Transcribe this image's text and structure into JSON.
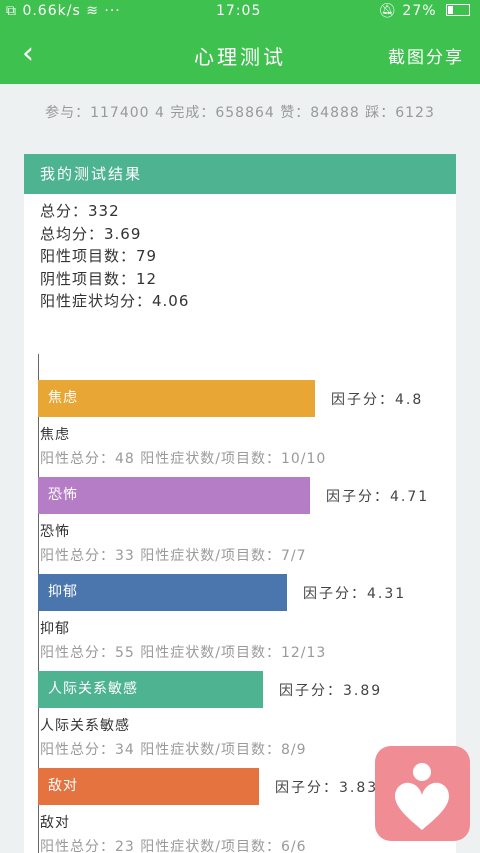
{
  "status": {
    "speed": "0.66k/s",
    "dots": "···",
    "time": "17:05",
    "battery": "27%"
  },
  "appbar": {
    "back": "‹",
    "title": "心理测试",
    "share": "截图分享"
  },
  "stats": "参与：117400 4 完成：658864 赞：84888 踩：6123",
  "card": {
    "header": "我的测试结果",
    "summary": [
      "总分：332",
      "总均分：3.69",
      "阳性项目数：79",
      "阴性项目数：12",
      "阳性症状均分：4.06"
    ]
  },
  "chart_data": {
    "type": "bar",
    "orientation": "horizontal",
    "categories": [
      "焦虑",
      "恐怖",
      "抑郁",
      "人际关系敏感",
      "敌对"
    ],
    "values": [
      4.8,
      4.71,
      4.31,
      3.89,
      3.83
    ],
    "value_labels": [
      "因子分：4.8",
      "因子分：4.71",
      "因子分：4.31",
      "因子分：3.89",
      "因子分：3.83"
    ],
    "colors": [
      "#e8a634",
      "#b57dc5",
      "#4a76ad",
      "#4db390",
      "#e57340"
    ],
    "xlim": [
      0,
      5
    ]
  },
  "factors": [
    {
      "name": "焦虑",
      "detail": "阳性总分：48   阳性症状数/项目数：10/10"
    },
    {
      "name": "恐怖",
      "detail": "阳性总分：33   阳性症状数/项目数：7/7"
    },
    {
      "name": "抑郁",
      "detail": "阳性总分：55   阳性症状数/项目数：12/13"
    },
    {
      "name": "人际关系敏感",
      "detail": "阳性总分：34   阳性症状数/项目数：8/9"
    },
    {
      "name": "敌对",
      "detail": "阳性总分：23   阳性症状数/项目数：6/6"
    }
  ]
}
